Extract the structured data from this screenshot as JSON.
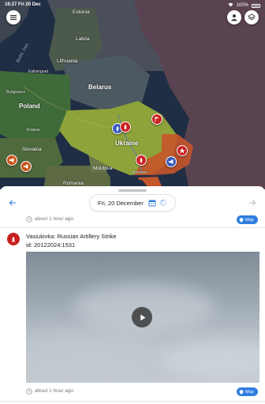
{
  "status_bar": {
    "time": "16:27",
    "date": "Fri 20 Dec",
    "battery": "100%"
  },
  "map": {
    "labels": {
      "estonia": "Estonia",
      "baltic_sea": "Baltic Sea",
      "latvia": "Latvia",
      "lithuania": "Lithuania",
      "kaliningrad": "Kaliningrad",
      "belarus": "Belarus",
      "poland": "Poland",
      "krakow": "Krakow",
      "slovakia": "Slovakia",
      "ukraine": "Ukraine",
      "moldova": "Moldova",
      "romania": "Romania",
      "bydgoszcz": "Bydgoszcz",
      "kherson": "Kherson"
    }
  },
  "sheet": {
    "date": "Fri, 20 December",
    "events": [
      {
        "time_ago": "about 1 hour ago",
        "map_label": "Map"
      },
      {
        "title": "Vasiukivka: Russian Artillery Strike",
        "id": "id: 20122024:1531",
        "time_ago": "about 1 hour ago",
        "map_label": "Map"
      }
    ]
  }
}
